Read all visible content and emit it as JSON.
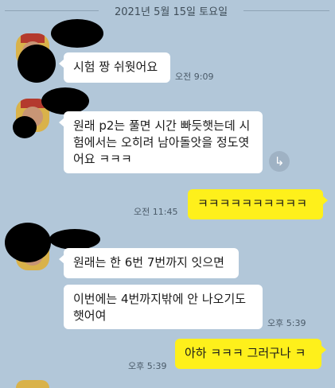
{
  "date_divider": "2021년 5월 15일 토요일",
  "messages": [
    {
      "text": "시험 짱 쉬웟어요",
      "time": "오전 9:09"
    },
    {
      "text": "원래 p2는 풀면 시간 빠듯햇는데 시험에서는 오히려 남아돌앗을 정도엿어요 ㅋㅋㅋ"
    },
    {
      "text": "ㅋㅋㅋㅋㅋㅋㅋㅋㅋㅋ",
      "time": "오전 11:45"
    },
    {
      "text": "원래는 한 6번 7번까지 잇으면"
    },
    {
      "text": "이번에는 4번까지밖에 안 나오기도 햇어여",
      "time": "오후 5:39"
    },
    {
      "text": "아하 ㅋㅋㅋ 그러구나 ㅋ",
      "time": "오후 5:39"
    }
  ],
  "share_icon": "share-arrow-icon",
  "colors": {
    "background": "#b2c7d9",
    "my_bubble": "#fef01b",
    "other_bubble": "#ffffff"
  }
}
